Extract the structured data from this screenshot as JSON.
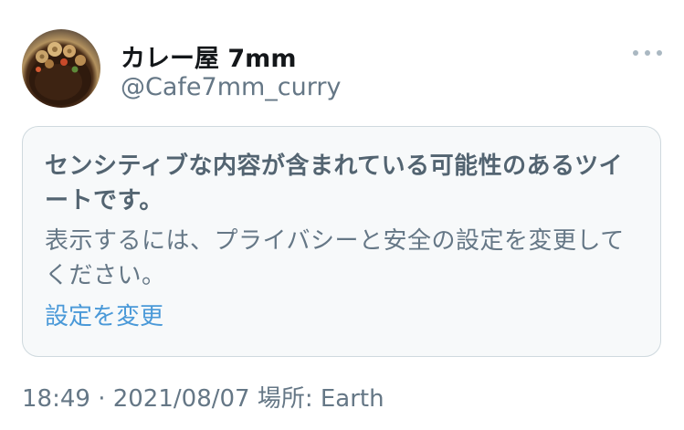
{
  "tweet": {
    "display_name": "カレー屋 7mm",
    "handle": "@Cafe7mm_curry",
    "avatar_icon": "curry-plate-avatar",
    "more_icon": "more-dots-icon"
  },
  "sensitive_notice": {
    "title": "センシティブな内容が含まれている可能性のあるツイートです。",
    "body": "表示するには、プライバシーと安全の設定を変更してください。",
    "link_label": "設定を変更",
    "link_color": "#4a99d8"
  },
  "meta": {
    "line": "18:49 · 2021/08/07 場所: Earth"
  },
  "colors": {
    "name_text": "#14171a",
    "secondary_text": "#657786",
    "card_background": "#f7f9fa",
    "card_border": "#cfd9de"
  }
}
